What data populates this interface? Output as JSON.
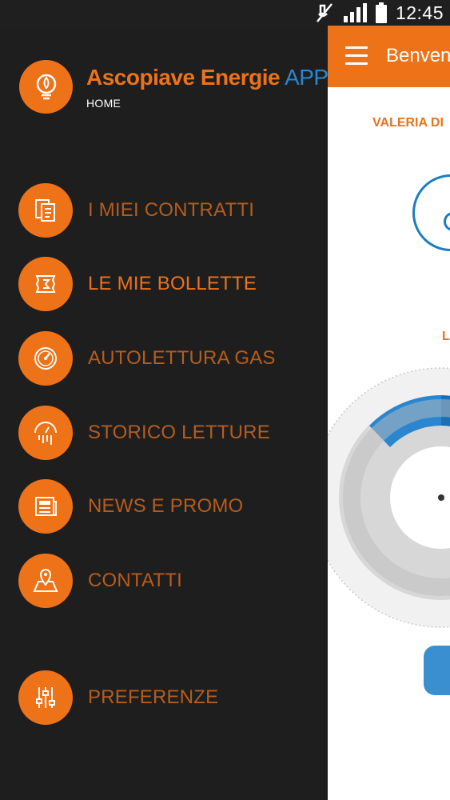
{
  "status_bar": {
    "time": "12:45",
    "icons": [
      "mute-icon",
      "signal-icon",
      "battery-icon"
    ]
  },
  "main": {
    "app_bar_title": "Benvenu",
    "customer_name": "VALERIA DI",
    "section_letter": "L"
  },
  "drawer": {
    "brand_name": "Ascopiave Energie",
    "brand_suffix": "APP",
    "current_section": "HOME",
    "items": [
      {
        "label": "I MIEI CONTRATTI",
        "icon": "contracts-icon",
        "active": false
      },
      {
        "label": "LE MIE BOLLETTE",
        "icon": "bills-icon",
        "active": true
      },
      {
        "label": "AUTOLETTURA GAS",
        "icon": "gauge-icon",
        "active": false
      },
      {
        "label": "STORICO LETTURE",
        "icon": "history-icon",
        "active": false
      },
      {
        "label": "NEWS E PROMO",
        "icon": "news-icon",
        "active": false
      },
      {
        "label": "CONTATTI",
        "icon": "map-pin-icon",
        "active": false
      }
    ],
    "preferences_label": "PREFERENZE"
  },
  "colors": {
    "accent": "#ee7217",
    "accent_dim": "#b65d1d",
    "brand_blue": "#2a86cf",
    "drawer_bg": "#1e1e1e"
  }
}
